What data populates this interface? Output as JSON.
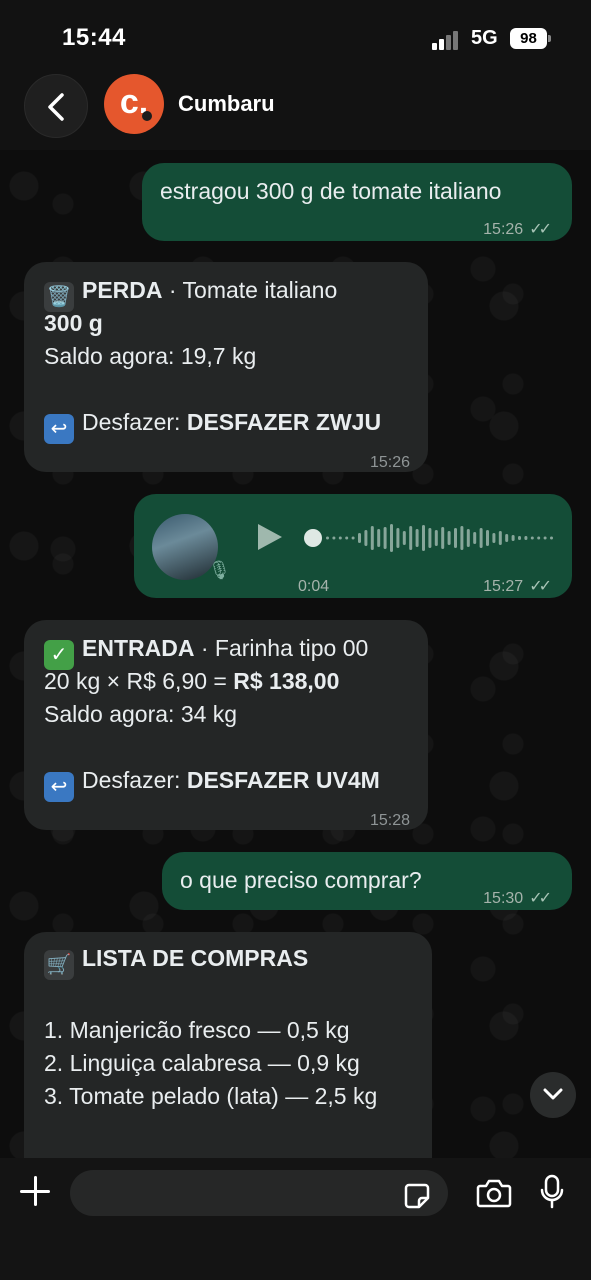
{
  "status_bar": {
    "time": "15:44",
    "network": "5G",
    "battery": "98"
  },
  "header": {
    "avatar_letter": "c.",
    "title": "Cumbaru"
  },
  "messages": [
    {
      "dir": "out",
      "text": "estragou 300 g de tomate italiano",
      "time": "15:26",
      "ticks": "✓✓"
    },
    {
      "dir": "in",
      "icon": "🗑️",
      "title_bold": "PERDA",
      "title_rest": " · Tomate italiano",
      "line2": "300 g",
      "line3": "Saldo agora: 19,7 kg",
      "undo_icon": "↩",
      "undo_label": "Desfazer: ",
      "undo_code": "DESFAZER ZWJU",
      "time": "15:26"
    },
    {
      "dir": "out",
      "kind": "voice",
      "duration": "0:04",
      "time": "15:27",
      "ticks": "✓✓"
    },
    {
      "dir": "in",
      "icon": "✅",
      "title_bold": "ENTRADA",
      "title_rest": " · Farinha tipo 00",
      "line2_rest": "20 kg × R$ 6,90 = ",
      "line2_bold": "R$ 138,00",
      "line3": "Saldo agora: 34 kg",
      "undo_icon": "↩",
      "undo_label": "Desfazer: ",
      "undo_code": "DESFAZER UV4M",
      "time": "15:28"
    },
    {
      "dir": "out",
      "text": "o que preciso comprar?",
      "time": "15:30",
      "ticks": "✓✓"
    },
    {
      "dir": "in",
      "icon": "🛒",
      "title_bold": "LISTA DE COMPRAS",
      "items": [
        "1. Manjericão fresco — 0,5 kg",
        "2. Linguiça calabresa — 0,9 kg",
        "3. Tomate pelado (lata) — 2,5 kg"
      ]
    }
  ],
  "composer": {
    "placeholder": ""
  },
  "colors": {
    "outgoing": "#144d37",
    "incoming": "#242626",
    "avatar": "#e5572d"
  },
  "icons": [
    "back-arrow-icon",
    "plus-icon",
    "sticker-icon",
    "camera-icon",
    "microphone-icon",
    "chevron-down-icon",
    "play-icon",
    "trash-icon",
    "check-icon",
    "cart-icon",
    "undo-icon"
  ]
}
